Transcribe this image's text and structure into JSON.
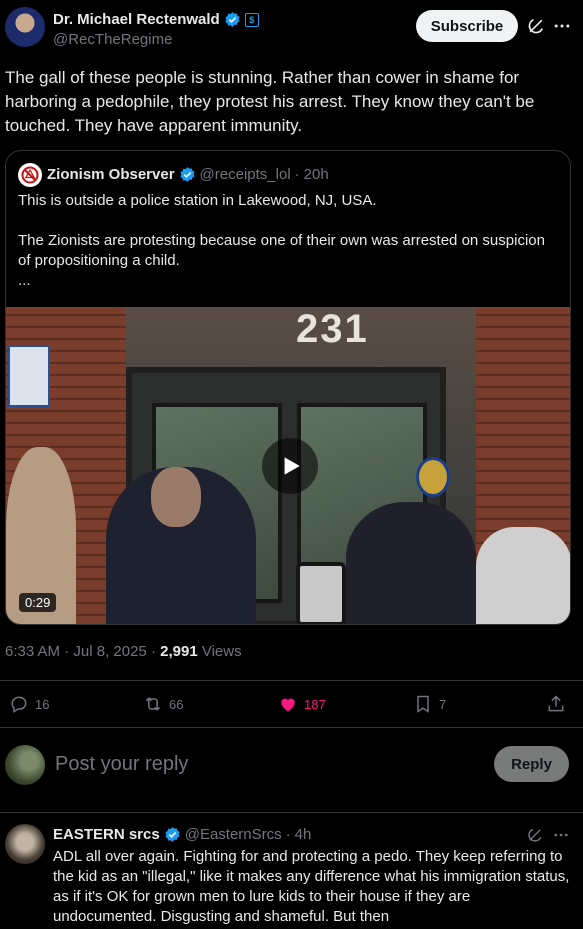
{
  "post": {
    "author_name": "Dr. Michael Rectenwald",
    "author_handle": "@RecTheRegime",
    "subscribe_label": "Subscribe",
    "text": "The gall of these people is stunning. Rather than cower in shame for harboring a pedophile, they protest his arrest. They know they can't be touched. They have apparent immunity."
  },
  "quote": {
    "author_name": "Zionism Observer",
    "author_handle": "@receipts_lol",
    "separator": "·",
    "time": "20h",
    "lines": [
      "This is outside a police station in Lakewood, NJ, USA.",
      "",
      "The Zionists are protesting because one of their own was arrested on suspicion of propositioning a child.",
      "..."
    ],
    "video": {
      "duration": "0:29",
      "sign_number": "231"
    }
  },
  "meta": {
    "time": "6:33 AM",
    "date": "Jul 8, 2025",
    "separator": "·",
    "views_count": "2,991",
    "views_label": "Views"
  },
  "actions": {
    "replies": "16",
    "reposts": "66",
    "likes": "187",
    "bookmarks": "7"
  },
  "composer": {
    "placeholder": "Post your reply",
    "reply_label": "Reply"
  },
  "reply": {
    "author_name": "EASTERN srcs",
    "author_handle": "@EasternSrcs",
    "separator": "·",
    "time": "4h",
    "text": "ADL all over again. Fighting for and protecting a pedo. They keep referring to the kid as an \"illegal,\" like it makes any difference what his immigration status, as if it's OK for grown men to lure kids to their house if they are undocumented. Disgusting and shameful. But then"
  },
  "colors": {
    "background": "#000000",
    "text": "#e7e9ea",
    "muted": "#71767b",
    "accent": "#1d9bf0",
    "like": "#f91880",
    "border": "#2f3336"
  },
  "icons": [
    "verified-icon",
    "grok-icon",
    "more-icon",
    "play-icon",
    "reply-icon",
    "repost-icon",
    "like-icon",
    "bookmark-icon",
    "share-icon"
  ]
}
